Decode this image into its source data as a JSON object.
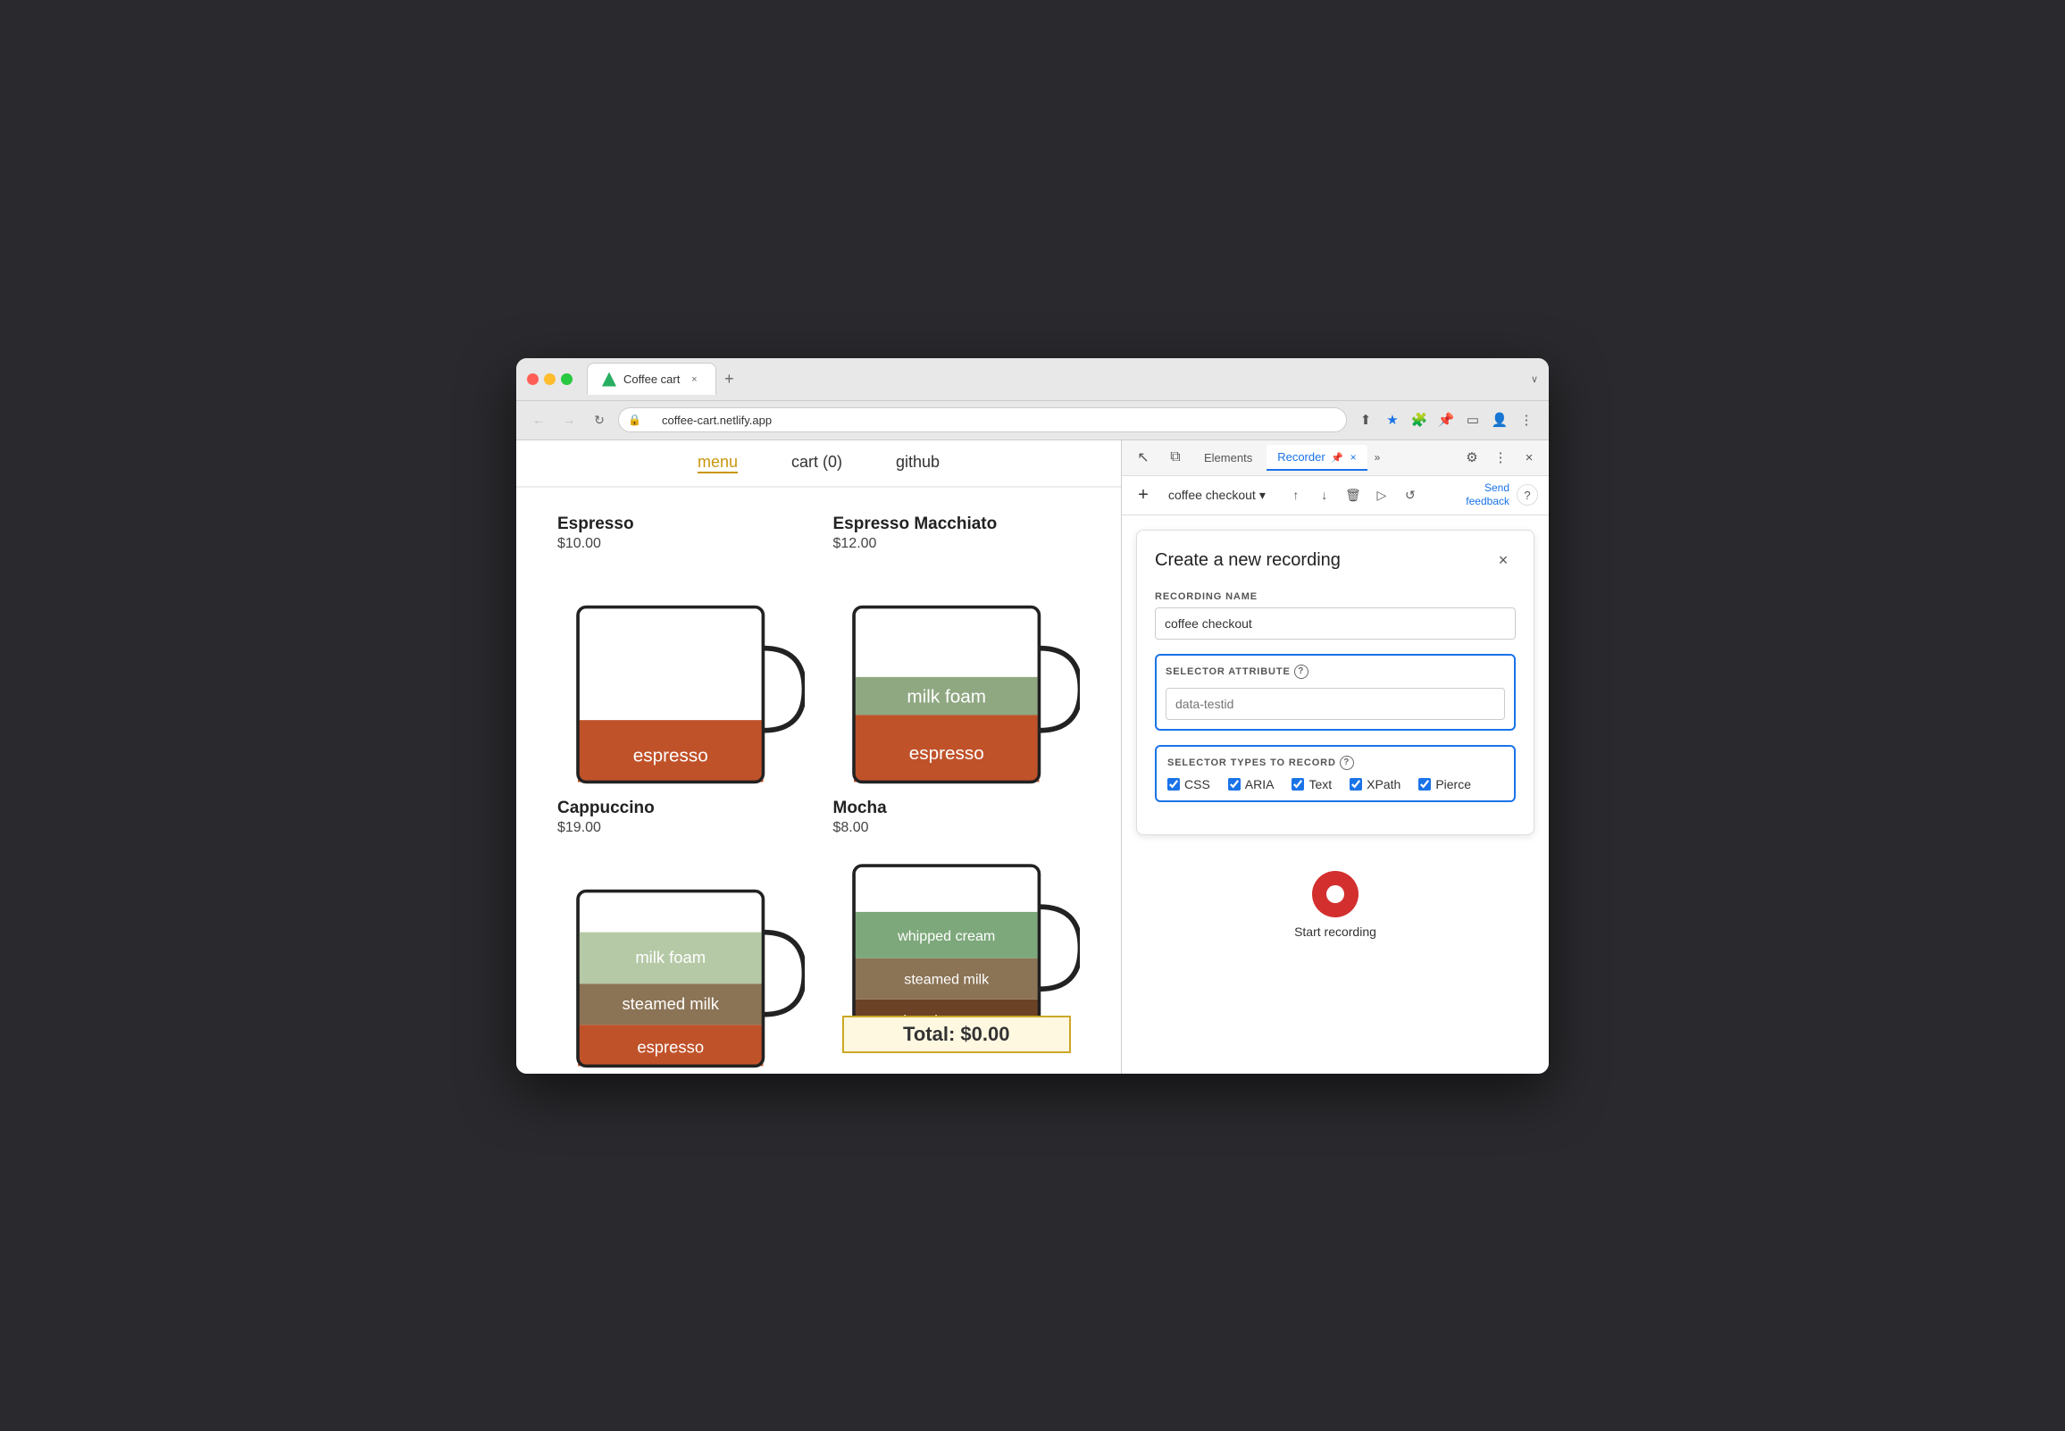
{
  "browser": {
    "tab_title": "Coffee cart",
    "url": "coffee-cart.netlify.app",
    "new_tab_label": "+",
    "nav_back": "←",
    "nav_forward": "→",
    "nav_refresh": "↻"
  },
  "website": {
    "nav": {
      "menu_label": "menu",
      "cart_label": "cart (0)",
      "github_label": "github"
    },
    "products": [
      {
        "name": "Espresso",
        "price": "$10.00",
        "layers": [
          {
            "label": "espresso",
            "color": "#c0522a",
            "height": 60
          }
        ]
      },
      {
        "name": "Espresso Macchiato",
        "price": "$12.00",
        "layers": [
          {
            "label": "espresso",
            "color": "#c0522a",
            "height": 55
          },
          {
            "label": "milk foam",
            "color": "#8fa882",
            "height": 35
          }
        ]
      },
      {
        "name": "Cappuccino",
        "price": "$19.00",
        "layers": [
          {
            "label": "espresso",
            "color": "#c0522a",
            "height": 40
          },
          {
            "label": "steamed milk",
            "color": "#8b7355",
            "height": 40
          },
          {
            "label": "milk foam",
            "color": "#b5c9a6",
            "height": 50
          }
        ]
      },
      {
        "name": "Mocha",
        "price": "$8.00",
        "layers": [
          {
            "label": "chocolate syrup",
            "color": "#6b4226",
            "height": 40
          },
          {
            "label": "steamed milk",
            "color": "#8b7355",
            "height": 40
          },
          {
            "label": "whipped cream",
            "color": "#7da87b",
            "height": 45
          }
        ],
        "total_overlay": "Total: $0.00"
      }
    ]
  },
  "devtools": {
    "tabs": [
      "Elements",
      "Recorder",
      ""
    ],
    "recorder_tab_label": "Recorder",
    "elements_tab_label": "Elements",
    "tab_pin_icon": "📌",
    "close_tab_icon": "×",
    "more_icon": "»",
    "settings_icon": "⚙",
    "menu_icon": "⋮",
    "close_icon": "×"
  },
  "recorder_toolbar": {
    "add_icon": "+",
    "recording_name": "coffee checkout",
    "dropdown_icon": "▾",
    "upload_icon": "↑",
    "download_icon": "↓",
    "delete_icon": "🗑",
    "play_icon": "▷",
    "replay_icon": "↺",
    "send_feedback_label": "Send\nfeedback",
    "help_icon": "?"
  },
  "dialog": {
    "title": "Create a new recording",
    "close_icon": "×",
    "recording_name_label": "RECORDING NAME",
    "recording_name_value": "coffee checkout",
    "selector_attribute_label": "SELECTOR ATTRIBUTE",
    "selector_attribute_placeholder": "data-testid",
    "selector_types_label": "SELECTOR TYPES TO RECORD",
    "checkboxes": [
      {
        "label": "CSS",
        "checked": true
      },
      {
        "label": "ARIA",
        "checked": true
      },
      {
        "label": "Text",
        "checked": true
      },
      {
        "label": "XPath",
        "checked": true
      },
      {
        "label": "Pierce",
        "checked": true
      }
    ],
    "start_recording_label": "Start recording"
  }
}
